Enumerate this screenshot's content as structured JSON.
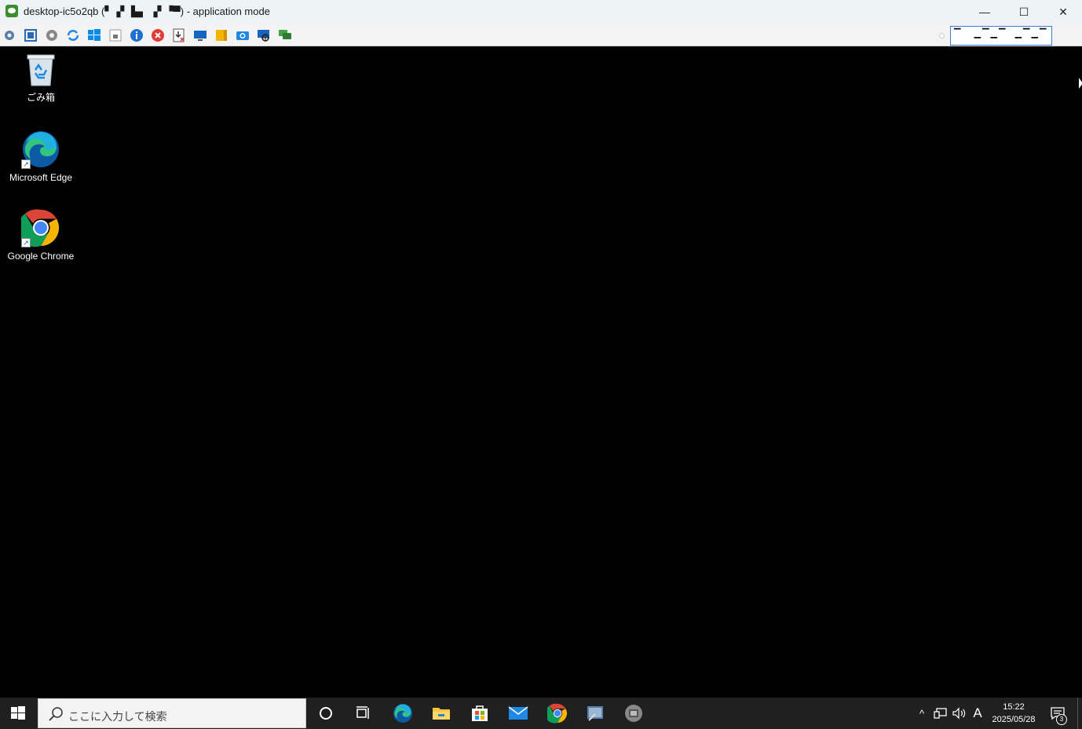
{
  "window": {
    "title": "desktop-ic5o2qb (▘▗▘ ▙▖ ▗▘▝▀) - application mode",
    "minimize_glyph": "—",
    "maximize_glyph": "☐",
    "close_glyph": "✕"
  },
  "toolbar": {
    "icons": [
      "settings-menu-icon",
      "fullscreen-icon",
      "options-gear-icon",
      "refresh-icon",
      "windows-start-icon",
      "keyboard-shortcut-icon",
      "info-icon",
      "disconnect-icon",
      "file-transfer-icon",
      "display-icon",
      "clipboard-icon",
      "screenshot-icon",
      "remote-control-icon",
      "chat-icon"
    ],
    "field_value": "▔   ▁▔▁▔  ▁▔▁▔"
  },
  "desktop": {
    "icons": [
      {
        "label": "ごみ箱",
        "icon": "recycle-bin-icon"
      },
      {
        "label": "Microsoft Edge",
        "icon": "edge-icon"
      },
      {
        "label": "Google Chrome",
        "icon": "chrome-icon"
      }
    ]
  },
  "taskbar": {
    "search_placeholder": "ここに入力して検索",
    "pinned": [
      "cortana-icon",
      "task-view-icon",
      "edge-icon",
      "file-explorer-icon",
      "store-icon",
      "mail-icon",
      "chrome-icon",
      "remote-app-icon",
      "settings-app-icon"
    ],
    "tray": {
      "chevron": "^",
      "ime": "A",
      "time": "15:22",
      "date": "2025/05/28",
      "notifications": "3"
    }
  },
  "colors": {
    "titlebar": "#eef3f6",
    "toolbar": "#f3f3f3",
    "desktop": "#000000",
    "taskbar": "#202020",
    "accent": "#3c7fd6"
  }
}
